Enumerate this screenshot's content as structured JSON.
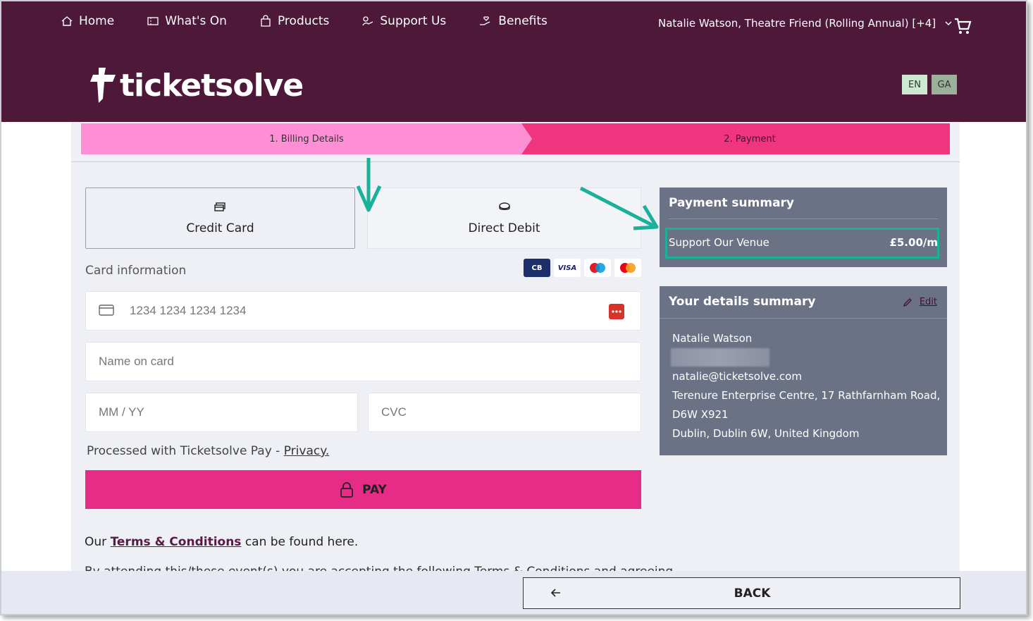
{
  "nav": {
    "items": [
      {
        "label": "Home",
        "icon": "home-icon"
      },
      {
        "label": "What's On",
        "icon": "calendar-icon"
      },
      {
        "label": "Products",
        "icon": "shopping-bag-icon"
      },
      {
        "label": "Support Us",
        "icon": "donate-icon"
      },
      {
        "label": "Benefits",
        "icon": "hand-heart-icon"
      }
    ],
    "user": "Natalie Watson, Theatre Friend (Rolling Annual) [+4]"
  },
  "logo": {
    "text": "ticketsolve"
  },
  "lang": {
    "en": "EN",
    "ga": "GA"
  },
  "steps": {
    "step1": "1. Billing Details",
    "step2": "2. Payment"
  },
  "payment_methods": {
    "credit": "Credit Card",
    "debit": "Direct Debit"
  },
  "card": {
    "info_label": "Card information",
    "brands": [
      "CB",
      "VISA",
      "Maestro",
      "Mastercard"
    ],
    "number_placeholder": "1234 1234 1234 1234",
    "name_placeholder": "Name on card",
    "expiry_placeholder": "MM / YY",
    "cvc_placeholder": "CVC"
  },
  "processed": {
    "text": "Processed with Ticketsolve Pay - ",
    "link": "Privacy."
  },
  "pay": {
    "label": "PAY"
  },
  "terms": {
    "prefix": "Our ",
    "link": "Terms & Conditions",
    "suffix": " can be found here.",
    "cutoff": "By attending this/these event(s) you are accepting the following Terms & Conditions and agreeing"
  },
  "payment_summary": {
    "title": "Payment summary",
    "item_label": "Support Our Venue",
    "item_amount": "£5.00/m"
  },
  "details_summary": {
    "title": "Your details summary",
    "edit": "Edit",
    "name": "Natalie Watson",
    "email": "natalie@ticketsolve.com",
    "address1": "Terenure Enterprise Centre, 17 Rathfarnham Road,",
    "address2": "D6W X921",
    "address3": "Dublin, Dublin 6W, United Kingdom"
  },
  "footer": {
    "back": "BACK"
  },
  "colors": {
    "header": "#4e1839",
    "pay": "#e62c87",
    "step1": "#ff8fd5",
    "step2": "#f0357e",
    "summary": "#6c7286",
    "annotation": "#1bb09a"
  }
}
